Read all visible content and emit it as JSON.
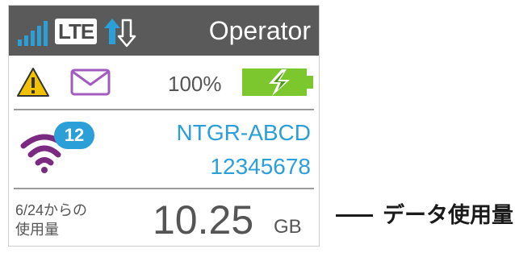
{
  "status_bar": {
    "network_type": "LTE",
    "operator": "Operator",
    "signal_bars": 5,
    "signal_icon": "signal-bars-icon",
    "data_icon": "up-down-arrows-icon"
  },
  "alerts": {
    "warning_icon": "warning-icon",
    "message_icon": "envelope-icon"
  },
  "battery": {
    "percent_text": "100%",
    "icon": "battery-charging-icon",
    "level": 1.0
  },
  "wifi": {
    "icon": "wifi-icon",
    "connected_devices": "12",
    "ssid": "NTGR-ABCD",
    "password": "12345678"
  },
  "usage": {
    "label_line1": "6/24からの",
    "label_line2": "使用量",
    "value": "10.25",
    "unit": "GB"
  },
  "callout": {
    "text": "データ使用量"
  },
  "colors": {
    "status_bar_bg": "#5a5a5a",
    "signal": "#2a9fd8",
    "accent_blue": "#2a9fd8",
    "wifi_purple": "#7b2a82",
    "mail_purple": "#a35bc2",
    "warning_yellow": "#f2c200",
    "battery_green": "#7cc62e"
  }
}
